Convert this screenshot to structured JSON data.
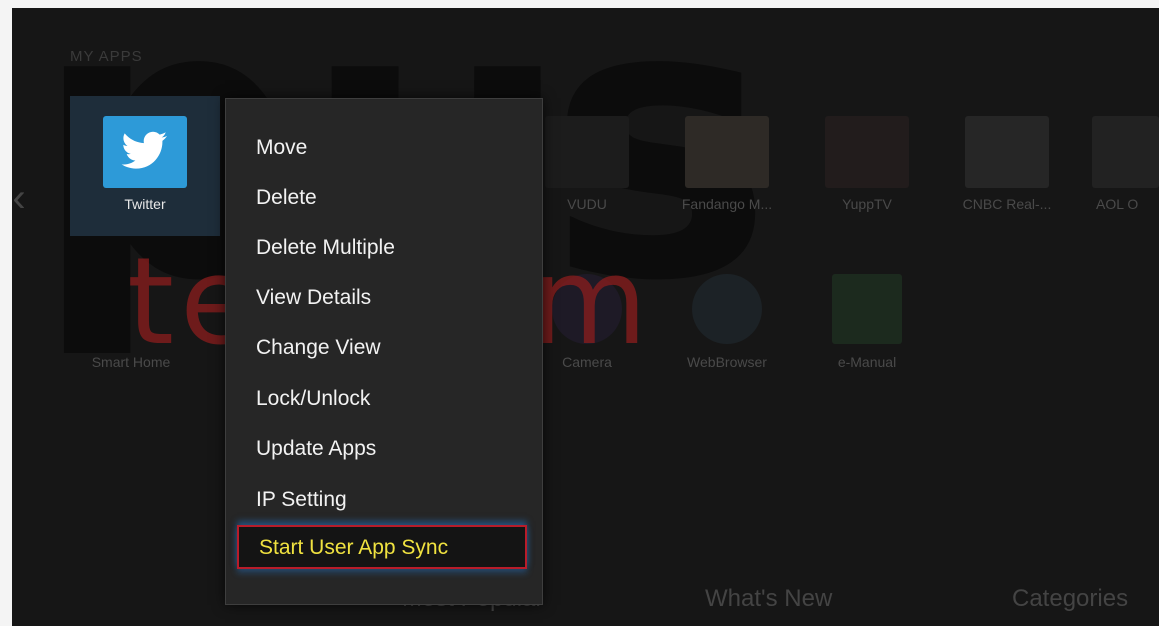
{
  "screen": {
    "section_title": "MY APPS",
    "watermark_text": "plus",
    "watermark_brand": "telecom"
  },
  "apps": {
    "row1": [
      {
        "label": "Twitter",
        "icon": "twitter-icon",
        "selected": true
      },
      {
        "label": "VUDU",
        "icon": "vudu-icon"
      },
      {
        "label": "Fandango M...",
        "icon": "fandango-icon"
      },
      {
        "label": "YuppTV",
        "icon": "yupptv-icon"
      },
      {
        "label": "CNBC Real-...",
        "icon": "cnbc-icon"
      },
      {
        "label": "AOL O",
        "icon": "aol-icon"
      }
    ],
    "row2": [
      {
        "label": "Smart Home",
        "icon": "smart-home-icon"
      },
      {
        "label": "Camera",
        "icon": "camera-icon"
      },
      {
        "label": "WebBrowser",
        "icon": "web-browser-icon"
      },
      {
        "label": "e-Manual",
        "icon": "e-manual-icon"
      }
    ]
  },
  "context_menu": {
    "items": [
      {
        "label": "Move"
      },
      {
        "label": "Delete"
      },
      {
        "label": "Delete Multiple"
      },
      {
        "label": "View Details"
      },
      {
        "label": "Change View"
      },
      {
        "label": "Lock/Unlock"
      },
      {
        "label": "Update Apps"
      },
      {
        "label": "IP Setting"
      },
      {
        "label": "Start User App Sync",
        "highlighted": true
      }
    ]
  },
  "bottom_tabs": [
    {
      "label": "Most Popular"
    },
    {
      "label": "What's New"
    },
    {
      "label": "Categories"
    }
  ],
  "colors": {
    "background": "#161616",
    "twitter_blue": "#2d9ad8",
    "highlight_text": "#f0e240",
    "highlight_border": "#b81c2a"
  }
}
